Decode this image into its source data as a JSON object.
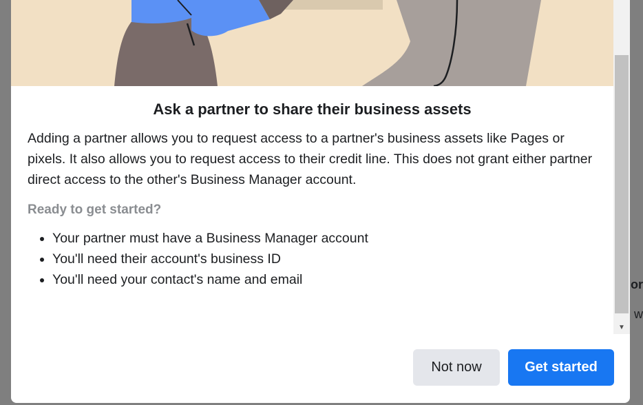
{
  "backdrop": {
    "text_fragment_1": "or",
    "text_fragment_2": "o w"
  },
  "dialog": {
    "title": "Ask a partner to share their business assets",
    "description": "Adding a partner allows you to request access to a partner's business assets like Pages or pixels. It also allows you to request access to their credit line. This does not grant either partner direct access to the other's Business Manager account.",
    "ready_heading": "Ready to get started?",
    "requirements": [
      "Your partner must have a Business Manager account",
      "You'll need their account's business ID",
      "You'll need your contact's name and email"
    ],
    "buttons": {
      "secondary_label": "Not now",
      "primary_label": "Get started"
    }
  },
  "colors": {
    "primary": "#1877f2",
    "illustration_background": "#f2e0c4",
    "muted_text": "#8a8d91"
  },
  "icons": {
    "scroll_down": "scroll-down-arrow-icon"
  }
}
